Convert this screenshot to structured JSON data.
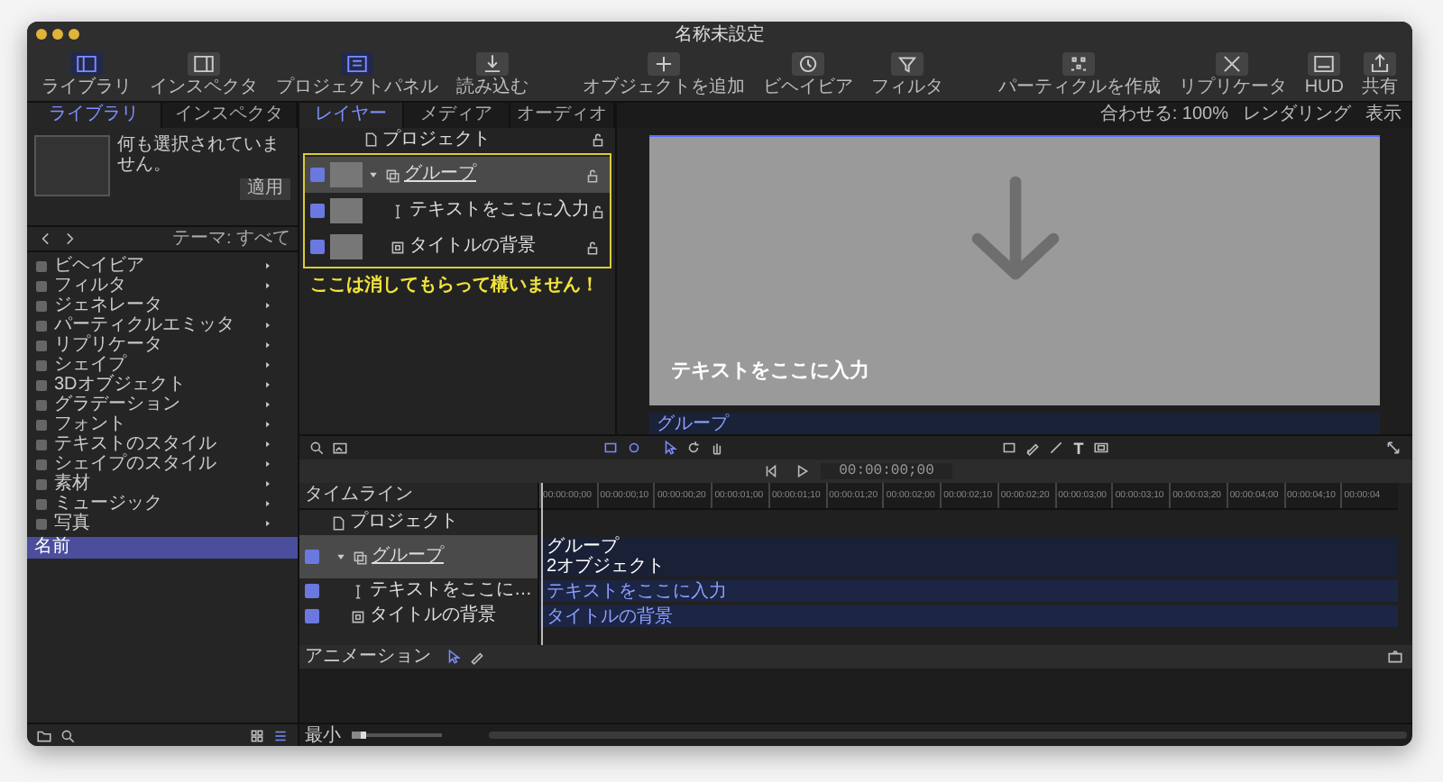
{
  "window": {
    "title": "名称未設定"
  },
  "toolbar": {
    "left": [
      {
        "kind": "library",
        "label": "ライブラリ",
        "selected": true
      },
      {
        "kind": "inspector",
        "label": "インスペクタ",
        "selected": false
      },
      {
        "kind": "project_panel",
        "label": "プロジェクトパネル",
        "selected": true
      },
      {
        "kind": "import",
        "label": "読み込む",
        "selected": false
      }
    ],
    "center": [
      {
        "kind": "add_object",
        "label": "オブジェクトを追加"
      },
      {
        "kind": "behavior",
        "label": "ビヘイビア"
      },
      {
        "kind": "filter",
        "label": "フィルタ"
      }
    ],
    "right": [
      {
        "kind": "particle",
        "label": "パーティクルを作成"
      },
      {
        "kind": "replicator",
        "label": "リプリケータ"
      },
      {
        "kind": "hud",
        "label": "HUD"
      },
      {
        "kind": "share",
        "label": "共有"
      }
    ]
  },
  "library": {
    "tabs": [
      {
        "label": "ライブラリ",
        "selected": true
      },
      {
        "label": "インスペクタ",
        "selected": false
      }
    ],
    "preview_text": "何も選択されていません。",
    "apply_button": "適用",
    "theme_filter": "テーマ: すべて",
    "categories": [
      {
        "label": "ビヘイビア"
      },
      {
        "label": "フィルタ"
      },
      {
        "label": "ジェネレータ"
      },
      {
        "label": "パーティクルエミッタ"
      },
      {
        "label": "リプリケータ"
      },
      {
        "label": "シェイプ"
      },
      {
        "label": "3Dオブジェクト"
      },
      {
        "label": "グラデーション"
      },
      {
        "label": "フォント"
      },
      {
        "label": "テキストのスタイル"
      },
      {
        "label": "シェイプのスタイル"
      },
      {
        "label": "素材"
      },
      {
        "label": "ミュージック"
      },
      {
        "label": "写真"
      }
    ],
    "list_header": "名前"
  },
  "layers_panel": {
    "tabs": [
      {
        "label": "レイヤー",
        "selected": true
      },
      {
        "label": "メディア",
        "selected": false
      },
      {
        "label": "オーディオ",
        "selected": false
      }
    ],
    "layers": [
      {
        "name": "プロジェクト",
        "kind": "project",
        "children": [
          {
            "name": "グループ",
            "kind": "group",
            "enabled": true,
            "selected": true,
            "expanded": true,
            "children": [
              {
                "name": "テキストをここに入力",
                "kind": "text",
                "enabled": true,
                "selected": false
              },
              {
                "name": "タイトルの背景",
                "kind": "shape",
                "enabled": true,
                "selected": false
              }
            ]
          }
        ]
      }
    ]
  },
  "canvas_bar": {
    "zoom": "合わせる: 100%",
    "render": "レンダリング",
    "view": "表示"
  },
  "canvas": {
    "text": "テキストをここに入力",
    "mini_timeline_label": "グループ"
  },
  "canvas_tools": {
    "text_tool": "T"
  },
  "transport": {
    "timecode": "00:00:00;00"
  },
  "timeline": {
    "title": "タイムライン",
    "ticks": [
      "00:00:00;00",
      "00:00:00;10",
      "00:00:00;20",
      "00:00:01;00",
      "00:00:01;10",
      "00:00:01;20",
      "00:00:02;00",
      "00:00:02;10",
      "00:00:02;20",
      "00:00:03;00",
      "00:00:03;10",
      "00:00:03;20",
      "00:00:04;00",
      "00:00:04;10",
      "00:00:04"
    ],
    "layers": [
      {
        "name": "プロジェクト",
        "kind": "project",
        "children": [
          {
            "name": "グループ",
            "kind": "group",
            "enabled": true,
            "selected": true,
            "expanded": true,
            "bar_title": "グループ",
            "bar_subtitle": "2オブジェクト",
            "children": [
              {
                "name": "テキストをここに…",
                "kind": "text",
                "enabled": true,
                "selected": false,
                "bar_title": "テキストをここに入力"
              },
              {
                "name": "タイトルの背景",
                "kind": "shape",
                "enabled": true,
                "selected": false,
                "bar_title": "タイトルの背景"
              }
            ]
          }
        ]
      }
    ]
  },
  "animation": {
    "title": "アニメーション"
  },
  "bottom_bar": {
    "zoom_label": "最小",
    "zoom_slider": {
      "level": 0.15
    }
  },
  "annotation": {
    "text": "ここは消してもらって構いません！"
  }
}
